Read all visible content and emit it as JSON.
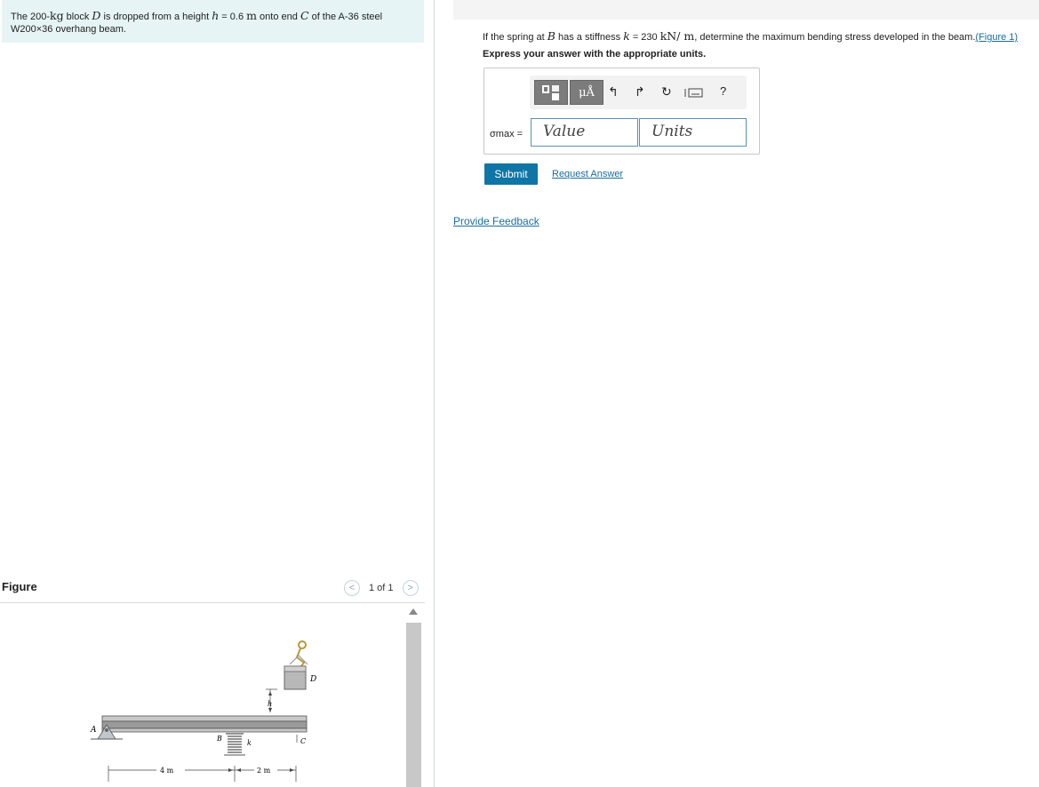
{
  "problem": {
    "t1": "The 200-",
    "kg": "kg",
    "t2": " block ",
    "D": "D",
    "t3": " is dropped from a height ",
    "h": "h",
    "t4": " = 0.6 ",
    "m": "m",
    "t5": " onto end ",
    "C": "C",
    "t6": " of the A-36 steel",
    "line2": "W200×36 overhang beam."
  },
  "figure_panel": {
    "label": "Figure",
    "page": "1 of 1",
    "prev": "<",
    "next": ">",
    "labels": {
      "A": "A",
      "B": "B",
      "k": "k",
      "C": "C",
      "D": "D",
      "h": "h",
      "dim1": "4 m",
      "dim2": "2 m"
    }
  },
  "question": {
    "t1": "If the spring at ",
    "B": "B",
    "t2": " has a stiffness ",
    "k": "k",
    "t3": " = 230 ",
    "unit": "kN/ m",
    "t4": ", determine the maximum bending stress developed in the beam.",
    "link": "(Figure 1)"
  },
  "instruction": "Express your answer with the appropriate units.",
  "toolbar": {
    "units_btn": "μÅ",
    "help": "?"
  },
  "answer": {
    "sigma_label": "σmax =",
    "value_placeholder": "Value",
    "units_placeholder": "Units"
  },
  "buttons": {
    "submit": "Submit",
    "request": "Request Answer",
    "feedback": "Provide Feedback"
  }
}
